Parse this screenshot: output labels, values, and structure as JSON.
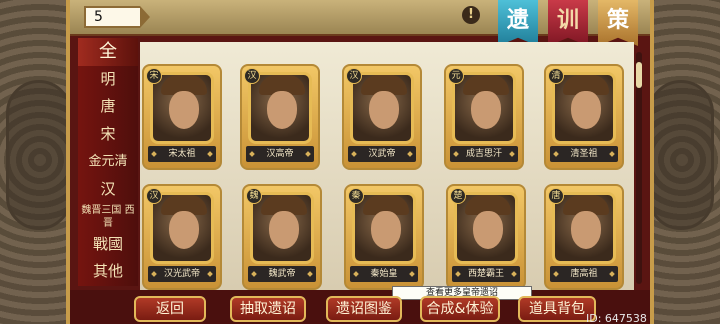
{
  "header": {
    "count_value": "5",
    "banners": [
      "遗",
      "训",
      "策"
    ]
  },
  "categories": [
    {
      "label": "全",
      "active": true
    },
    {
      "label": "明"
    },
    {
      "label": "唐"
    },
    {
      "label": "宋"
    },
    {
      "label": "金元清"
    },
    {
      "label": "汉"
    },
    {
      "label": "魏晋三国 西晋",
      "small": true
    },
    {
      "label": "戰國"
    },
    {
      "label": "其他"
    }
  ],
  "cards": [
    {
      "name": "宋太祖",
      "seal": "宋"
    },
    {
      "name": "汉高帝",
      "seal": "汉"
    },
    {
      "name": "汉武帝",
      "seal": "汉"
    },
    {
      "name": "成吉思汗",
      "seal": "元"
    },
    {
      "name": "清圣祖",
      "seal": "清"
    },
    {
      "name": "汉光武帝",
      "seal": "汉"
    },
    {
      "name": "魏武帝",
      "seal": "魏"
    },
    {
      "name": "秦始皇",
      "seal": "秦"
    },
    {
      "name": "西楚霸王",
      "seal": "楚"
    },
    {
      "name": "唐高祖",
      "seal": "唐"
    }
  ],
  "tooltip": "查看更多皇帝遗诏",
  "buttons": {
    "back": "返回",
    "draw": "抽取遗诏",
    "gallery": "遗诏图鉴",
    "synth": "合成&体验",
    "bag": "道具背包"
  },
  "user_id": "ID: 647538"
}
